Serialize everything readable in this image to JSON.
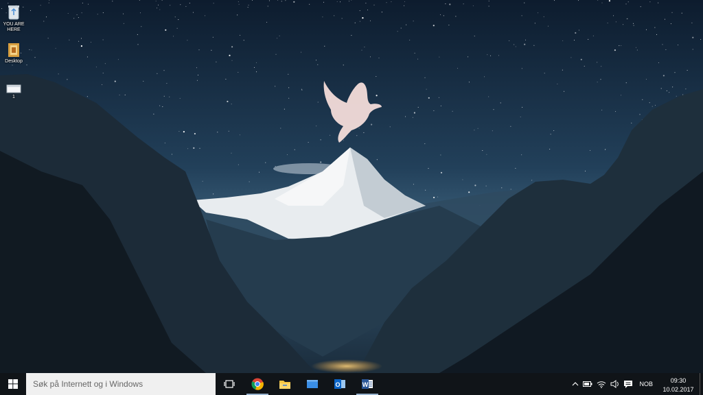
{
  "desktop": {
    "icons": [
      {
        "label": "YOU ARE HERE",
        "icon": "recycle-bin-icon"
      },
      {
        "label": "Desktop",
        "icon": "folder-icon"
      },
      {
        "label": "1",
        "icon": "image-file-icon"
      }
    ]
  },
  "taskbar": {
    "start_icon": "windows-logo-icon",
    "search_placeholder": "Søk på Internett og i Windows",
    "task_view_icon": "task-view-icon",
    "apps": [
      {
        "icon": "chrome-icon",
        "active": true
      },
      {
        "icon": "file-explorer-icon",
        "active": false
      },
      {
        "icon": "window-icon",
        "active": false
      },
      {
        "icon": "outlook-icon",
        "active": false
      },
      {
        "icon": "word-icon",
        "active": true
      }
    ],
    "tray": {
      "chevron_icon": "chevron-up-icon",
      "battery_icon": "battery-icon",
      "wifi_icon": "wifi-icon",
      "volume_icon": "volume-icon",
      "notifications_icon": "action-center-icon",
      "language": "NOB",
      "time": "09:30",
      "date": "10.02.2017"
    }
  },
  "colors": {
    "taskbar_bg": "#101418",
    "search_bg": "#f0f0f0",
    "sky_top": "#0d1c2e",
    "sky_mid": "#2b4a63"
  }
}
